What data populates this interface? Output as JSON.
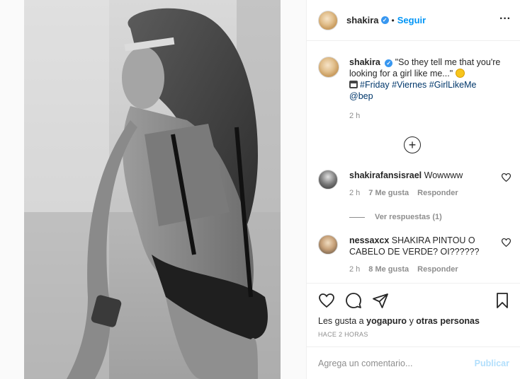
{
  "post": {
    "username": "shakira",
    "verified_icon": "verified-badge-icon",
    "separator": "•",
    "follow_label": "Seguir",
    "more_label": "···"
  },
  "caption": {
    "username": "shakira",
    "text_quote": "\"So they tell me that you're looking for a girl like me...\"",
    "hashtags": [
      "#Friday",
      "#Viernes",
      "#GirlLikeMe"
    ],
    "mention": "@bep",
    "time": "2 h"
  },
  "comments": [
    {
      "username": "shakirafansisrael",
      "text": "Wowwww",
      "time": "2 h",
      "likes": "7 Me gusta",
      "reply_label": "Responder",
      "view_replies": "Ver respuestas (1)"
    },
    {
      "username": "nessaxcx",
      "text": "SHAKIRA PINTOU O CABELO DE VERDE? OI??????",
      "time": "2 h",
      "likes": "8 Me gusta",
      "reply_label": "Responder"
    }
  ],
  "actions": {
    "likes_prefix": "Les gusta a",
    "likes_user": "yogapuro",
    "likes_join": "y",
    "likes_others": "otras personas",
    "time_ago": "HACE 2 HORAS"
  },
  "comment_box": {
    "placeholder": "Agrega un comentario...",
    "publish_label": "Publicar"
  },
  "colors": {
    "accent": "#0095f6",
    "hashtag": "#00376b",
    "muted": "#8e8e8e",
    "publish_disabled": "#b2dffc"
  }
}
